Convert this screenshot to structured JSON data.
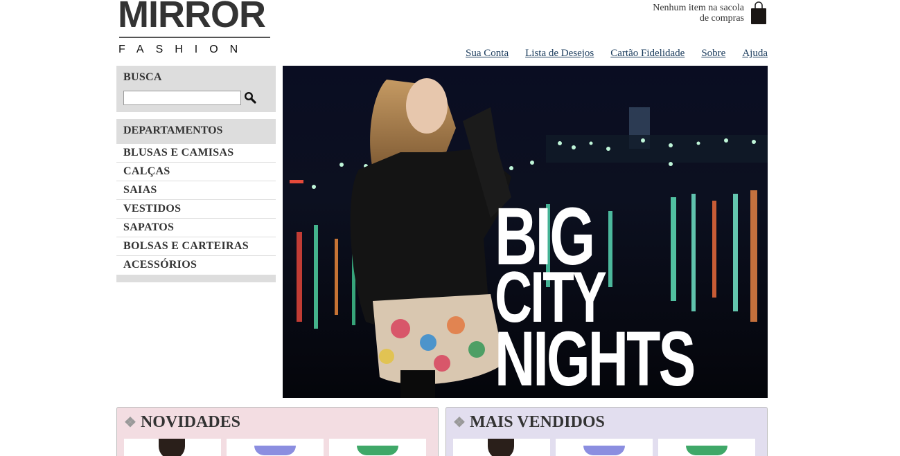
{
  "logo": {
    "brand": "MIRROR",
    "tagline": "FASHION"
  },
  "cart": {
    "status_line1": "Nenhum item na sacola",
    "status_line2": "de compras",
    "icon": "shopping-bag-icon"
  },
  "topnav": {
    "items": [
      {
        "label": "Sua Conta"
      },
      {
        "label": "Lista de Desejos"
      },
      {
        "label": "Cartão Fidelidade"
      },
      {
        "label": "Sobre"
      },
      {
        "label": "Ajuda"
      }
    ]
  },
  "search": {
    "title": "BUSCA",
    "input_value": "",
    "button_icon": "magnifier-icon"
  },
  "departments": {
    "title": "DEPARTAMENTOS",
    "items": [
      {
        "label": "BLUSAS E CAMISAS"
      },
      {
        "label": "CALÇAS"
      },
      {
        "label": "SAIAS"
      },
      {
        "label": "VESTIDOS"
      },
      {
        "label": "SAPATOS"
      },
      {
        "label": "BOLSAS E CARTEIRAS"
      },
      {
        "label": "ACESSÓRIOS"
      }
    ]
  },
  "banner": {
    "line1": "BIG",
    "line2": "CITY",
    "line3": "NIGHTS"
  },
  "panels": [
    {
      "title": "NOVIDADES",
      "color": "#f3dde2"
    },
    {
      "title": "MAIS VENDIDOS",
      "color": "#e2deef"
    }
  ],
  "colors": {
    "link": "#1a3b5c",
    "sidebar_bg": "#dddddd",
    "text": "#333333"
  }
}
